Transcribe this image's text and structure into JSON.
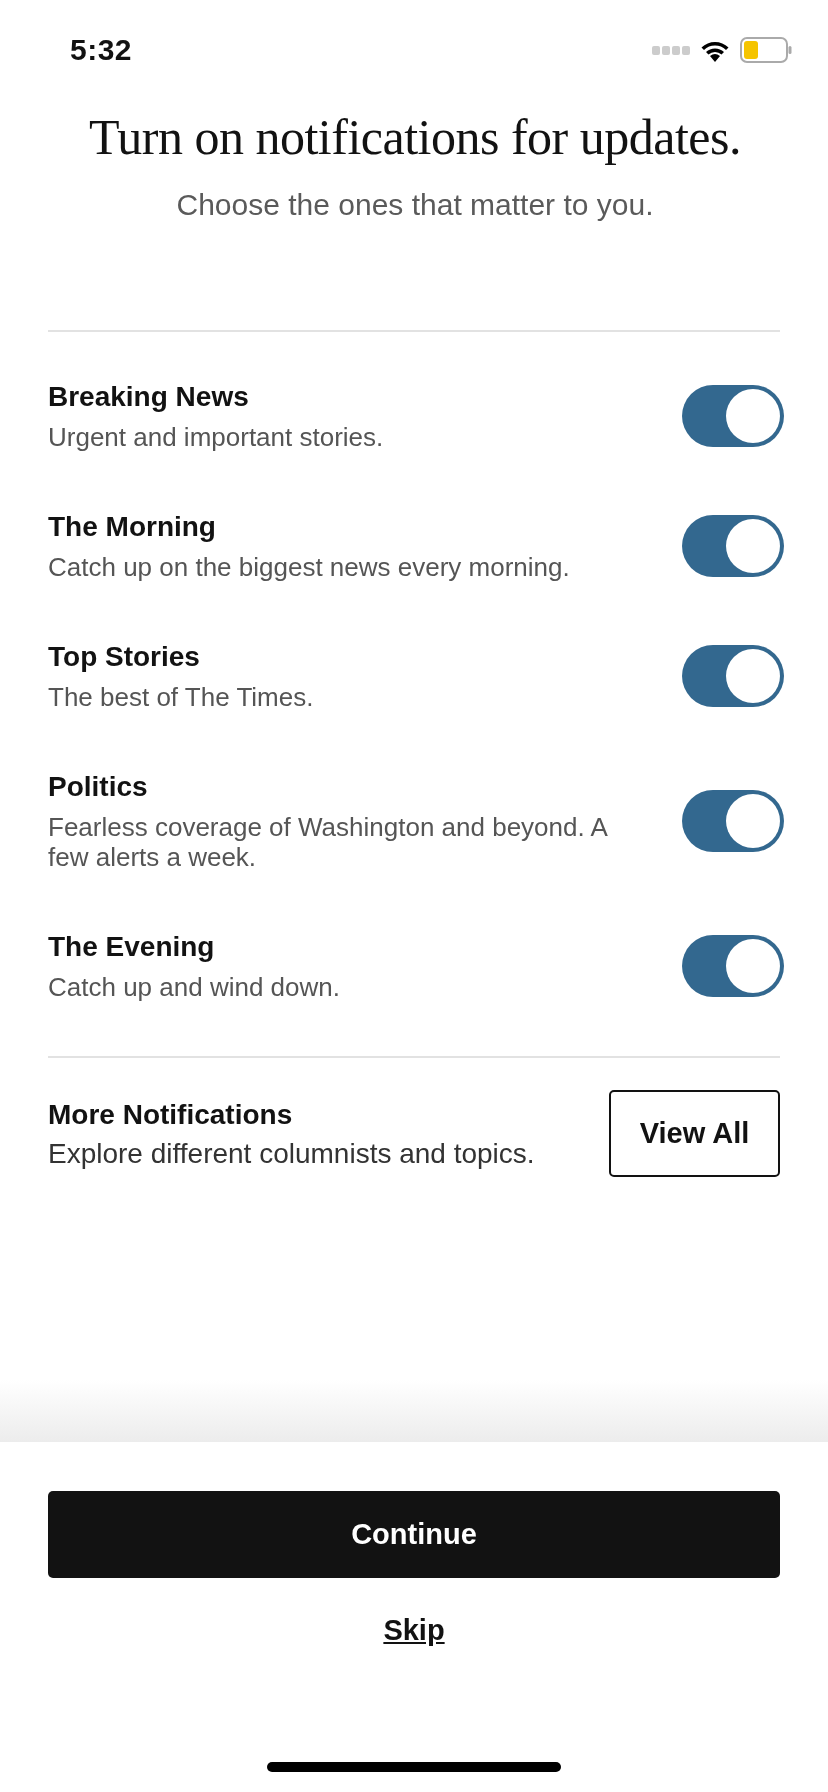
{
  "status_bar": {
    "time": "5:32"
  },
  "heading": "Turn on notifications for updates.",
  "subheading": "Choose the ones that matter to you.",
  "notifications": [
    {
      "title": "Breaking News",
      "description": "Urgent and important stories.",
      "on": true
    },
    {
      "title": "The Morning",
      "description": "Catch up on the biggest news every morning.",
      "on": true
    },
    {
      "title": "Top Stories",
      "description": "The best of The Times.",
      "on": true
    },
    {
      "title": "Politics",
      "description": "Fearless coverage of Washington and beyond. A few alerts a week.",
      "on": true
    },
    {
      "title": "The Evening",
      "description": "Catch up and wind down.",
      "on": true
    }
  ],
  "more": {
    "title": "More Notifications",
    "description": "Explore different columnists and topics.",
    "button": "View All"
  },
  "continue_button": "Continue",
  "skip_link": "Skip"
}
